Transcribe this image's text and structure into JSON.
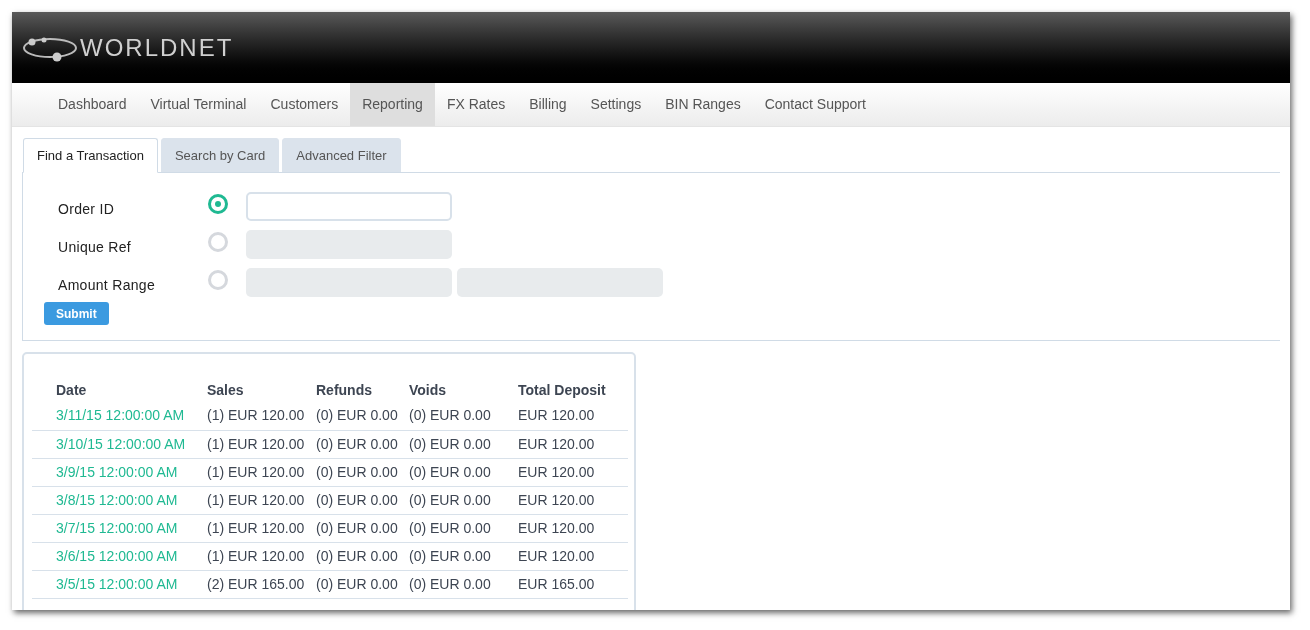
{
  "brand": {
    "name": "WORLDNET"
  },
  "nav": [
    {
      "label": "Dashboard",
      "selected": false
    },
    {
      "label": "Virtual Terminal",
      "selected": false
    },
    {
      "label": "Customers",
      "selected": false
    },
    {
      "label": "Reporting",
      "selected": true
    },
    {
      "label": "FX Rates",
      "selected": false
    },
    {
      "label": "Billing",
      "selected": false
    },
    {
      "label": "Settings",
      "selected": false
    },
    {
      "label": "BIN Ranges",
      "selected": false
    },
    {
      "label": "Contact Support",
      "selected": false
    }
  ],
  "tabs": [
    {
      "label": "Find a Transaction",
      "selected": true
    },
    {
      "label": "Search by Card",
      "selected": false
    },
    {
      "label": "Advanced Filter",
      "selected": false
    }
  ],
  "search_options": [
    {
      "label": "Order ID",
      "selected": true,
      "kind": "single"
    },
    {
      "label": "Unique Ref",
      "selected": false,
      "kind": "single"
    },
    {
      "label": "Amount Range",
      "selected": false,
      "kind": "range"
    }
  ],
  "submit_button": "Submit",
  "table": {
    "columns": [
      "Date",
      "Sales",
      "Refunds",
      "Voids",
      "Total Deposit"
    ],
    "rows": [
      [
        "3/11/15 12:00:00 AM",
        "(1) EUR 120.00",
        "(0) EUR 0.00",
        "(0) EUR 0.00",
        "EUR 120.00"
      ],
      [
        "3/10/15 12:00:00 AM",
        "(1) EUR 120.00",
        "(0) EUR 0.00",
        "(0) EUR 0.00",
        "EUR 120.00"
      ],
      [
        "3/9/15 12:00:00 AM",
        "(1) EUR 120.00",
        "(0) EUR 0.00",
        "(0) EUR 0.00",
        "EUR 120.00"
      ],
      [
        "3/8/15 12:00:00 AM",
        "(1) EUR 120.00",
        "(0) EUR 0.00",
        "(0) EUR 0.00",
        "EUR 120.00"
      ],
      [
        "3/7/15 12:00:00 AM",
        "(1) EUR 120.00",
        "(0) EUR 0.00",
        "(0) EUR 0.00",
        "EUR 120.00"
      ],
      [
        "3/6/15 12:00:00 AM",
        "(1) EUR 120.00",
        "(0) EUR 0.00",
        "(0) EUR 0.00",
        "EUR 120.00"
      ],
      [
        "3/5/15 12:00:00 AM",
        "(2) EUR 165.00",
        "(0) EUR 0.00",
        "(0) EUR 0.00",
        "EUR 165.00"
      ]
    ]
  }
}
